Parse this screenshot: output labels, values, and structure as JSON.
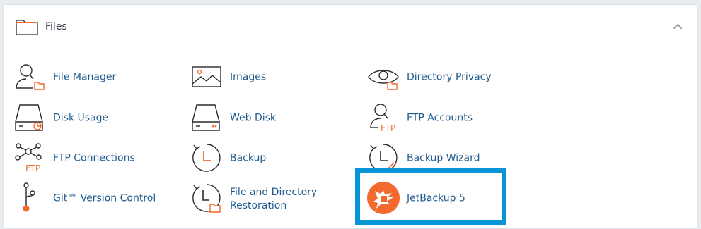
{
  "section": {
    "title": "Files",
    "items": [
      {
        "label": "File Manager",
        "icon": "file-manager-icon"
      },
      {
        "label": "Images",
        "icon": "images-icon"
      },
      {
        "label": "Directory Privacy",
        "icon": "directory-privacy-icon"
      },
      {
        "label": "Disk Usage",
        "icon": "disk-usage-icon"
      },
      {
        "label": "Web Disk",
        "icon": "web-disk-icon"
      },
      {
        "label": "FTP Accounts",
        "icon": "ftp-accounts-icon"
      },
      {
        "label": "FTP Connections",
        "icon": "ftp-connections-icon"
      },
      {
        "label": "Backup",
        "icon": "backup-icon"
      },
      {
        "label": "Backup Wizard",
        "icon": "backup-wizard-icon"
      },
      {
        "label": "Git™ Version Control",
        "icon": "git-version-control-icon"
      },
      {
        "label": "File and Directory Restoration",
        "icon": "file-restoration-icon"
      },
      {
        "label": "JetBackup 5",
        "icon": "jetbackup-icon"
      }
    ]
  },
  "icons": {
    "ftp_text": "FTP"
  },
  "colors": {
    "link": "#1f5a8e",
    "accent": "#f26a2e",
    "icon_stroke": "#2b2b2b",
    "highlight": "#0795d8"
  }
}
